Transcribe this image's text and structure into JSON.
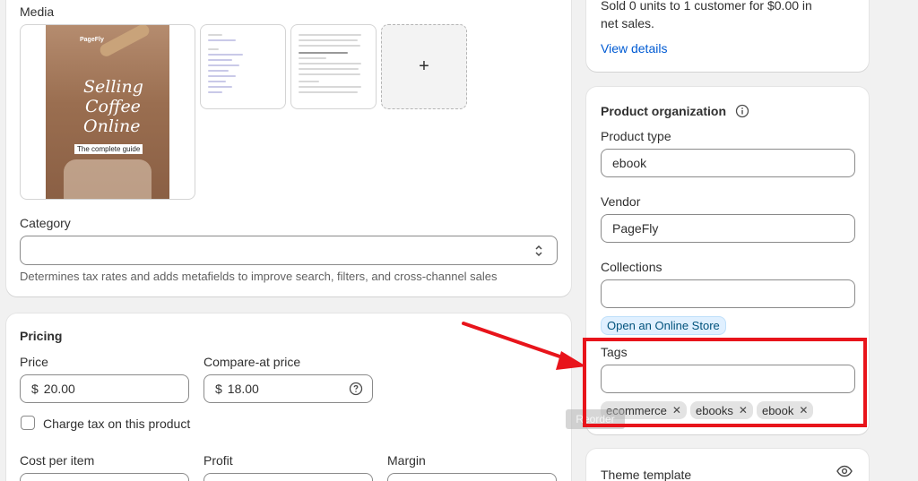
{
  "media": {
    "label": "Media",
    "cover": {
      "brand": "PageFly",
      "title_lines": [
        "Selling",
        "Coffee",
        "Online"
      ],
      "subtitle": "The complete guide"
    },
    "add_label": "+"
  },
  "category": {
    "label": "Category",
    "value": "",
    "help": "Determines tax rates and adds metafields to improve search, filters, and cross-channel sales"
  },
  "pricing": {
    "heading": "Pricing",
    "price_label": "Price",
    "price_currency": "$",
    "price_value": "20.00",
    "compare_label": "Compare-at price",
    "compare_currency": "$",
    "compare_value": "18.00",
    "charge_tax_label": "Charge tax on this product",
    "cost_label": "Cost per item",
    "profit_label": "Profit",
    "margin_label": "Margin"
  },
  "sales": {
    "text_line1": "Sold 0 units to 1 customer for $0.00 in",
    "text_line2": "net sales.",
    "link": "View details"
  },
  "organization": {
    "heading": "Product organization",
    "type_label": "Product type",
    "type_value": "ebook",
    "vendor_label": "Vendor",
    "vendor_value": "PageFly",
    "collections_label": "Collections",
    "collections_value": "",
    "collection_chip": "Open an Online Store",
    "tags_label": "Tags",
    "tags_value": "",
    "tags": [
      "ecommerce",
      "ebooks",
      "ebook"
    ],
    "remove_symbol": "✕"
  },
  "theme": {
    "label": "Theme template"
  },
  "overlay": {
    "ghost_text": "Reorder"
  },
  "colors": {
    "annotation_red": "#e8141b",
    "link_blue": "#005bd3",
    "chip_bg": "#e0f0ff"
  }
}
